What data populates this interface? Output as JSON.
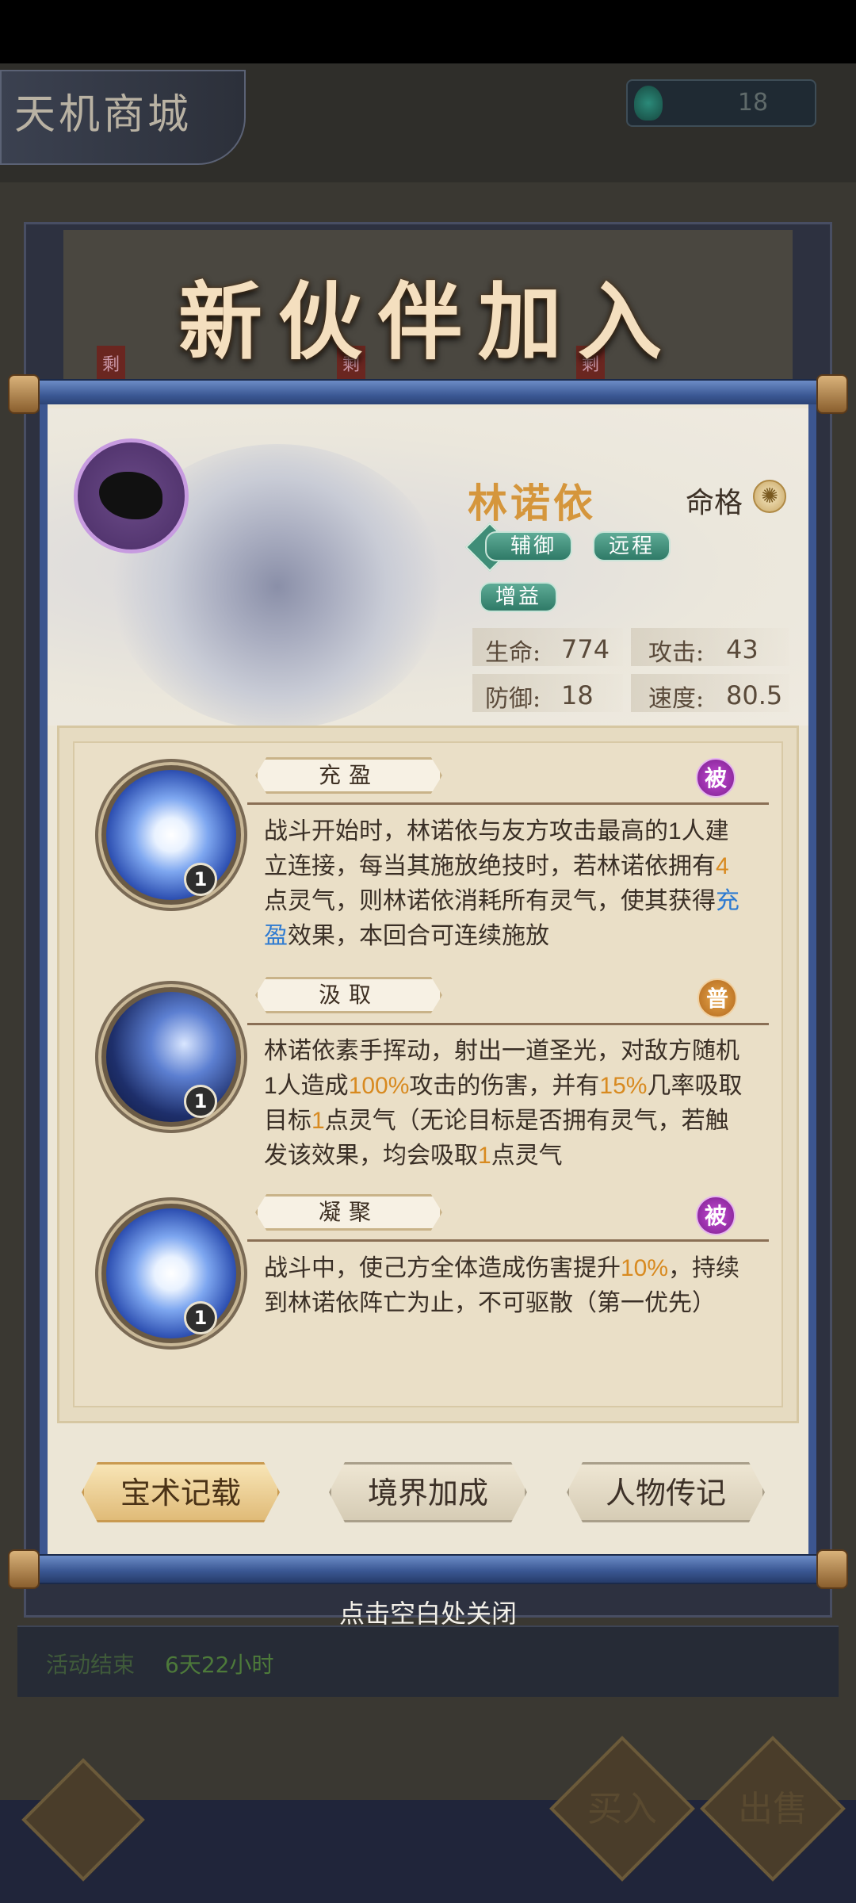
{
  "shop": {
    "title": "天机商城",
    "currency_value": "18"
  },
  "dialog": {
    "title": "新伙伴加入",
    "close_hint": "点击空白处关闭"
  },
  "background_tags": [
    "剩",
    "剩",
    "剩"
  ],
  "character": {
    "name": "林诺依",
    "fate_label": "命格",
    "tags": [
      "辅御",
      "远程",
      "增益"
    ],
    "stats": {
      "hp_label": "生命:",
      "hp_value": "774",
      "atk_label": "攻击:",
      "atk_value": "43",
      "def_label": "防御:",
      "def_value": "18",
      "spd_label": "速度:",
      "spd_value": "80.5"
    }
  },
  "skills": [
    {
      "name": "充盈",
      "type": "被",
      "level": "1",
      "desc_parts": [
        "战斗开始时，林诺依与友方攻击最高的1人建立连接，每当其施放绝技时，若林诺依拥有",
        "4",
        "点灵气，则林诺依消耗所有灵气，使其获得",
        "充盈",
        "效果，本回合可连续施放"
      ]
    },
    {
      "name": "汲取",
      "type": "普",
      "level": "1",
      "desc_parts": [
        "林诺依素手挥动，射出一道圣光，对敌方随机1人造成",
        "100%",
        "攻击的伤害，并有",
        "15%",
        "几率吸取目标",
        "1",
        "点灵气（无论目标是否拥有灵气，若触发该效果，均会吸取",
        "1",
        "点灵气"
      ]
    },
    {
      "name": "凝聚",
      "type": "被",
      "level": "1",
      "desc_parts": [
        "战斗中，使己方全体造成伤害提升",
        "10%",
        "，持续到林诺依阵亡为止，不可驱散（第一优先）"
      ]
    }
  ],
  "buttons": {
    "treasure": "宝术记载",
    "realm": "境界加成",
    "biography": "人物传记"
  },
  "event": {
    "label": "活动结束",
    "time": "6天22小时"
  },
  "actions": {
    "buy": "买入",
    "sell": "出售"
  }
}
